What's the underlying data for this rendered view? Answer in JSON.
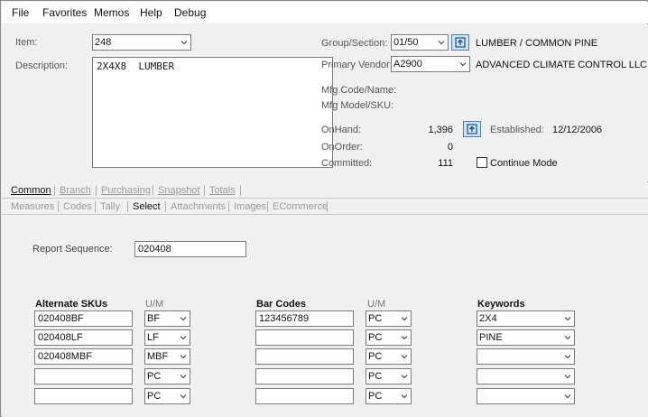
{
  "menu": [
    "File",
    "Favorites",
    "Memos",
    "Help",
    "Debug"
  ],
  "item": {
    "label": "Item:",
    "value": "248",
    "description_label": "Description:",
    "description": "2X4X8  LUMBER"
  },
  "group": {
    "label": "Group/Section:",
    "value": "01/50",
    "name": "LUMBER / COMMON PINE"
  },
  "vendor": {
    "label": "Primary Vendor:",
    "value": "A2900",
    "name": "ADVANCED CLIMATE CONTROL LLC"
  },
  "mfg": {
    "code_label": "Mfg Code/Name:",
    "model_label": "Mfg Model/SKU:"
  },
  "stock": {
    "onhand_label": "OnHand:",
    "onhand": "1,396",
    "onorder_label": "OnOrder:",
    "onorder": "0",
    "committed_label": "Committed:",
    "committed": "111",
    "established_label": "Established:",
    "established": "12/12/2006",
    "continue_mode_label": "Continue Mode"
  },
  "tabs_primary": [
    "Common",
    "Branch",
    "Purchasing",
    "Snapshot",
    "Totals"
  ],
  "tabs_secondary": [
    "Measures",
    "Codes",
    "Tally",
    "Select",
    "Attachments",
    "Images",
    "ECommerce"
  ],
  "select_tab": {
    "report_sequence_label": "Report Sequence:",
    "report_sequence": "020408",
    "alt_skus_header": "Alternate SKUs",
    "um_header": "U/M",
    "barcodes_header": "Bar Codes",
    "barcodes_um_header": "U/M",
    "keywords_header": "Keywords",
    "alt_skus": [
      {
        "sku": "020408BF",
        "um": "BF"
      },
      {
        "sku": "020408LF",
        "um": "LF"
      },
      {
        "sku": "020408MBF",
        "um": "MBF"
      },
      {
        "sku": "",
        "um": "PC"
      },
      {
        "sku": "",
        "um": "PC"
      }
    ],
    "barcodes": [
      {
        "code": "123456789",
        "um": "PC"
      },
      {
        "code": "",
        "um": "PC"
      },
      {
        "code": "",
        "um": "PC"
      },
      {
        "code": "",
        "um": "PC"
      },
      {
        "code": "",
        "um": "PC"
      }
    ],
    "keywords": [
      "2X4",
      "PINE",
      "",
      "",
      ""
    ]
  },
  "icons": {
    "upload": "upload-arrow-icon",
    "dropdown": "chevron-down-icon"
  },
  "colors": {
    "accent_button": "#cfe3f6",
    "accent_border": "#4a7fb5"
  }
}
